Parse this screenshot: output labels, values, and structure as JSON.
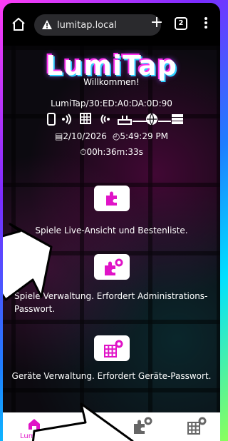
{
  "browser": {
    "url": "lumitap.local",
    "tab_count": "2"
  },
  "header": {
    "logo_text": "LumiTap",
    "welcome": "Willkommen!",
    "device_id": "LumiTap/30:ED:A0:DA:0D:90",
    "date": "2/10/2026",
    "time": "5:49:29 PM",
    "uptime": "00h:36m:33s"
  },
  "cards": [
    {
      "label": "Spiele Live-Ansicht und Bestenliste.",
      "icon": "puzzle-icon"
    },
    {
      "label": "Spiele Verwaltung. Erfordert Administrations-Passwort.",
      "icon": "puzzle-gear-icon"
    },
    {
      "label": "Geräte Verwaltung. Erfordert Geräte-Passwort.",
      "icon": "grid-gear-icon"
    }
  ],
  "bottom_nav": {
    "items": [
      {
        "label": "LumiTap",
        "icon": "home-icon",
        "active": true
      },
      {
        "label": "",
        "icon": "puzzle-gear-icon",
        "active": false
      },
      {
        "label": "",
        "icon": "grid-gear-icon",
        "active": false
      }
    ]
  },
  "colors": {
    "accent": "#e013c7",
    "background": "#0c0a10"
  }
}
